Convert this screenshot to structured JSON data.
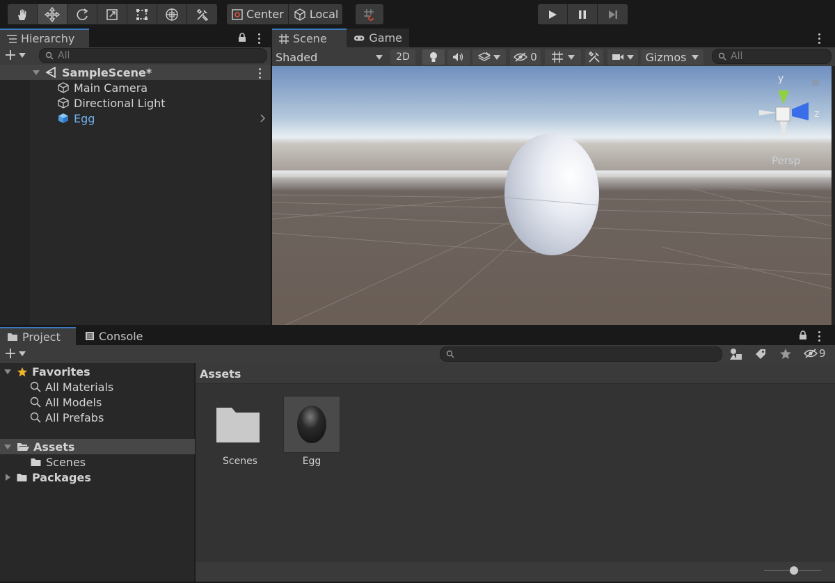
{
  "toolbar": {
    "tools": [
      "hand-icon",
      "move-icon",
      "rotate-icon",
      "scale-icon",
      "rect-icon",
      "transform-icon",
      "custom-tool-icon"
    ],
    "pivot_label": "Center",
    "space_label": "Local",
    "playback": [
      "play-icon",
      "pause-icon",
      "step-icon"
    ]
  },
  "hierarchy": {
    "tab_label": "Hierarchy",
    "search_placeholder": "All",
    "scene_name": "SampleScene*",
    "items": [
      {
        "label": "Main Camera"
      },
      {
        "label": "Directional Light"
      },
      {
        "label": "Egg"
      }
    ]
  },
  "scene_view": {
    "tabs": [
      {
        "label": "Scene"
      },
      {
        "label": "Game"
      }
    ],
    "shading_mode": "Shaded",
    "mode_2d": "2D",
    "hidden_count": "0",
    "gizmos_label": "Gizmos",
    "search_placeholder": "All",
    "gizmo": {
      "y_label": "y",
      "z_label": "z",
      "projection": "Persp"
    },
    "colors": {
      "y_axis": "#8fd13f",
      "z_axis": "#3a6ee8",
      "selected": "#4f9ce0"
    }
  },
  "project": {
    "tabs": [
      {
        "label": "Project"
      },
      {
        "label": "Console"
      }
    ],
    "hidden_packages_count": "9",
    "favorites_label": "Favorites",
    "favorites": [
      {
        "label": "All Materials"
      },
      {
        "label": "All Models"
      },
      {
        "label": "All Prefabs"
      }
    ],
    "assets_label": "Assets",
    "assets_children": [
      {
        "label": "Scenes"
      }
    ],
    "packages_label": "Packages",
    "breadcrumb": "Assets",
    "grid_items": [
      {
        "label": "Scenes"
      },
      {
        "label": "Egg"
      }
    ]
  }
}
